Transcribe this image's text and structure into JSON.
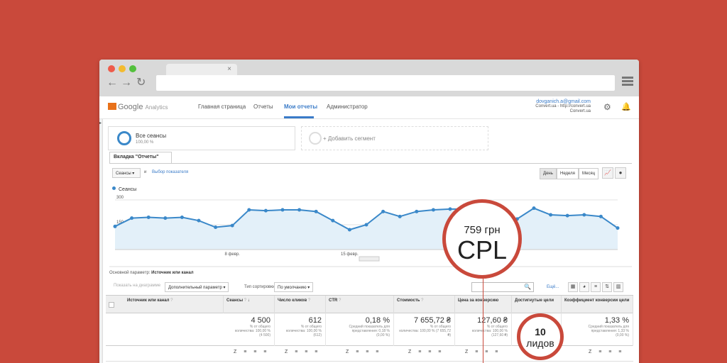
{
  "browser": {
    "tab_close": "×",
    "back_icon": "←",
    "forward_icon": "→",
    "reload_icon": "↻"
  },
  "header": {
    "logo_google": "Google",
    "logo_product": "Analytics",
    "nav": [
      "Главная страница",
      "Отчеты",
      "Мои отчеты",
      "Администратор"
    ],
    "active_nav": "Мои отчеты",
    "account_email": "dovganich.a@gmail.com",
    "account_line2": "Convert.ua - http://convert.ua",
    "account_line3": "Convert.ua"
  },
  "segments": {
    "seg1_title": "Все сеансы",
    "seg1_sub": "100,00 %",
    "seg2_title": "+ Добавить сегмент"
  },
  "report_tab": "Вкладка \"Отчеты\"",
  "controls": {
    "metric": "Сеансы",
    "and": "и",
    "choose_metric": "Выбор показателя",
    "periods": [
      "День",
      "Неделя",
      "Месяц"
    ],
    "active_period": "День"
  },
  "chart_data": {
    "type": "area",
    "series": [
      {
        "name": "Сеансы",
        "values": [
          140,
          190,
          195,
          190,
          195,
          175,
          135,
          145,
          240,
          235,
          240,
          240,
          230,
          175,
          120,
          150,
          230,
          200,
          230,
          240,
          245,
          245,
          240,
          190,
          185,
          250,
          210,
          205,
          210,
          200,
          130
        ]
      }
    ],
    "ylim": [
      0,
      300
    ],
    "yticks": [
      "300",
      "150"
    ],
    "xticks": [
      {
        "label": "8 февр.",
        "index": 7
      },
      {
        "label": "15 февр.",
        "index": 14
      }
    ],
    "color": "#3a88c9",
    "fill": "#e3f0f9"
  },
  "primary_dim": {
    "label": "Основной параметр:",
    "value": "Источник или канал"
  },
  "toolbar": {
    "show_on_chart": "Показать на диаграмме",
    "extra_param": "Дополнительный параметр",
    "sort_type_label": "Тип сортировки:",
    "sort_type_value": "По умолчанию",
    "more": "Ещё..."
  },
  "table": {
    "columns": [
      "Источник или канал",
      "Сеансы",
      "Число кликов",
      "CTR",
      "Стоимость",
      "Цена за конверсию",
      "Достигнутые цели",
      "Коэффициент конверсии цели"
    ],
    "totals": [
      {
        "value": "4 500",
        "sub1": "% от общего",
        "sub2": "количества: 100,00 %",
        "sub3": "(4 500)"
      },
      {
        "value": "612",
        "sub1": "% от общего",
        "sub2": "количества: 100,00 %",
        "sub3": "(612)"
      },
      {
        "value": "0,18 %",
        "sub1": "Средний показатель для",
        "sub2": "представления: 0,18 %",
        "sub3": "(0,00 %)"
      },
      {
        "value": "7 655,72 ₴",
        "sub1": "% от общего",
        "sub2": "количества: 100,00 % (7 655,72 ₴)",
        "sub3": ""
      },
      {
        "value": "127,60 ₴",
        "sub1": "% от общего",
        "sub2": "количества: 100,00 %",
        "sub3": "(127,60 ₴)"
      },
      {
        "value": "",
        "sub1": "",
        "sub2": "",
        "sub3": ""
      },
      {
        "value": "1,33 %",
        "sub1": "Средний показатель для",
        "sub2": "представления: 1,33 %",
        "sub3": "(0,00 %)"
      }
    ],
    "row_icons": "Z ≡ ≡ ≡"
  },
  "callouts": {
    "cpl_value": "759 грн",
    "cpl_label": "CPL",
    "leads_value": "10",
    "leads_label": "лидов"
  },
  "colors": {
    "background": "#c9493b",
    "accent": "#3a88c9",
    "link": "#3a7bc8"
  }
}
